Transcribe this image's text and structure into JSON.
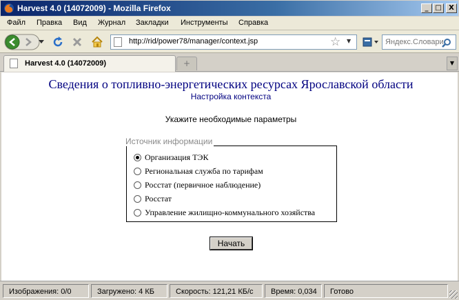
{
  "window": {
    "title": "Harvest 4.0 (14072009) - Mozilla Firefox",
    "controls": {
      "minimize": "_",
      "maximize": "□",
      "close": "X"
    }
  },
  "menu": {
    "items": [
      "Файл",
      "Правка",
      "Вид",
      "Журнал",
      "Закладки",
      "Инструменты",
      "Справка"
    ]
  },
  "nav": {
    "url": "http://rid/power78/manager/context.jsp",
    "search_placeholder": "Яндекс.Словари"
  },
  "tabs": {
    "active_label": "Harvest 4.0 (14072009)",
    "new_tab": "+"
  },
  "page": {
    "title": "Сведения о топливно-энергетических ресурсах Ярославской области",
    "subtitle": "Настройка контекста",
    "prompt": "Укажите необходимые параметры",
    "source_legend": "Источник информации",
    "options": [
      {
        "label": "Организация ТЭК",
        "checked": true
      },
      {
        "label": "Региональная служба по тарифам",
        "checked": false
      },
      {
        "label": "Росстат (первичное наблюдение)",
        "checked": false
      },
      {
        "label": "Росстат",
        "checked": false
      },
      {
        "label": "Управление жилищно-коммунального хозяйства",
        "checked": false
      }
    ],
    "start_button": "Начать"
  },
  "status": {
    "images": "Изображения: 0/0",
    "loaded": "Загружено: 4 КБ",
    "speed": "Скорость: 121,21 КБ/с",
    "time": "Время: 0,034",
    "state": "Готово"
  },
  "colors": {
    "title_text": "#000080",
    "titlebar": "#0a246a",
    "chrome": "#d4d0c8"
  }
}
